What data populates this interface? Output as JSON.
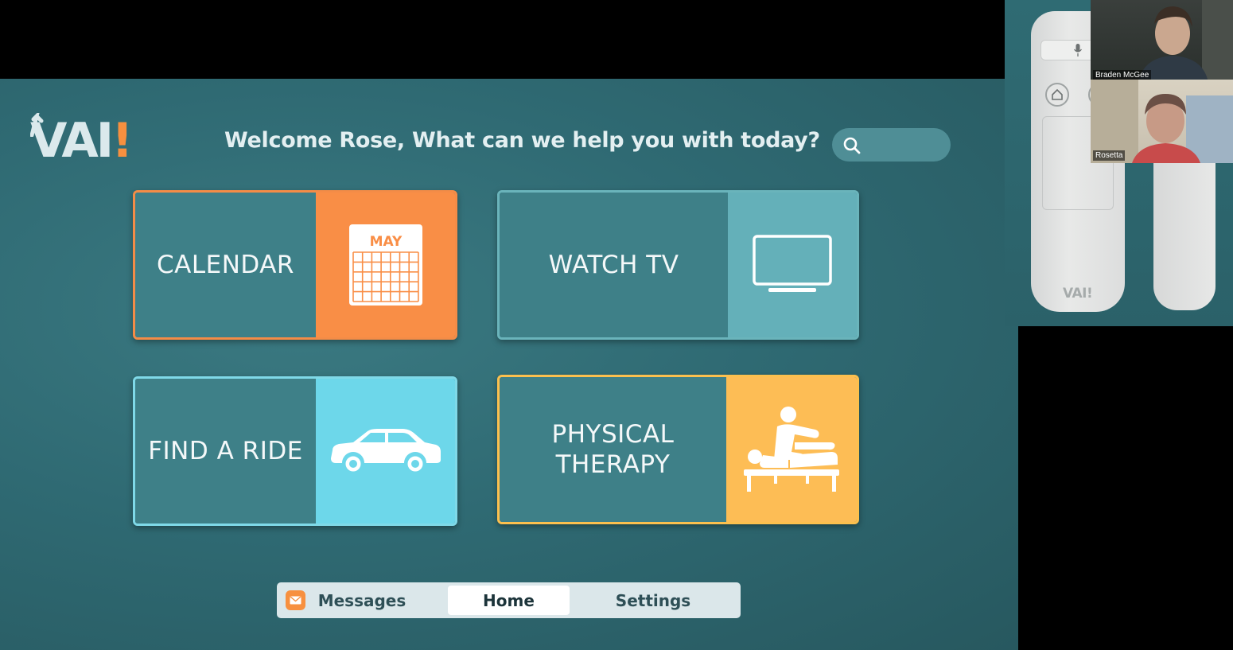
{
  "app": {
    "logo_text": "VAI",
    "logo_bang": "!",
    "welcome": "Welcome Rose, What can we help you with today?"
  },
  "search": {
    "icon": "search-icon"
  },
  "tiles": [
    {
      "label": "CALENDAR",
      "icon": "calendar-icon",
      "icon_text": "MAY",
      "color": "#f98e46"
    },
    {
      "label": "WATCH TV",
      "icon": "tv-icon",
      "color": "#64b0b9"
    },
    {
      "label": "FIND A RIDE",
      "icon": "car-icon",
      "color": "#6dd7ea"
    },
    {
      "label": "PHYSICAL THERAPY",
      "icon": "massage-therapy-icon",
      "color": "#fdbd55"
    }
  ],
  "nav": {
    "messages": "Messages",
    "home": "Home",
    "settings": "Settings",
    "active": "Home"
  },
  "video_call": {
    "participants": [
      "Braden McGee",
      "Rosetta"
    ],
    "remote_logo": "VAI!"
  },
  "colors": {
    "background": "#2f6a73",
    "accent_orange": "#f7903f"
  }
}
